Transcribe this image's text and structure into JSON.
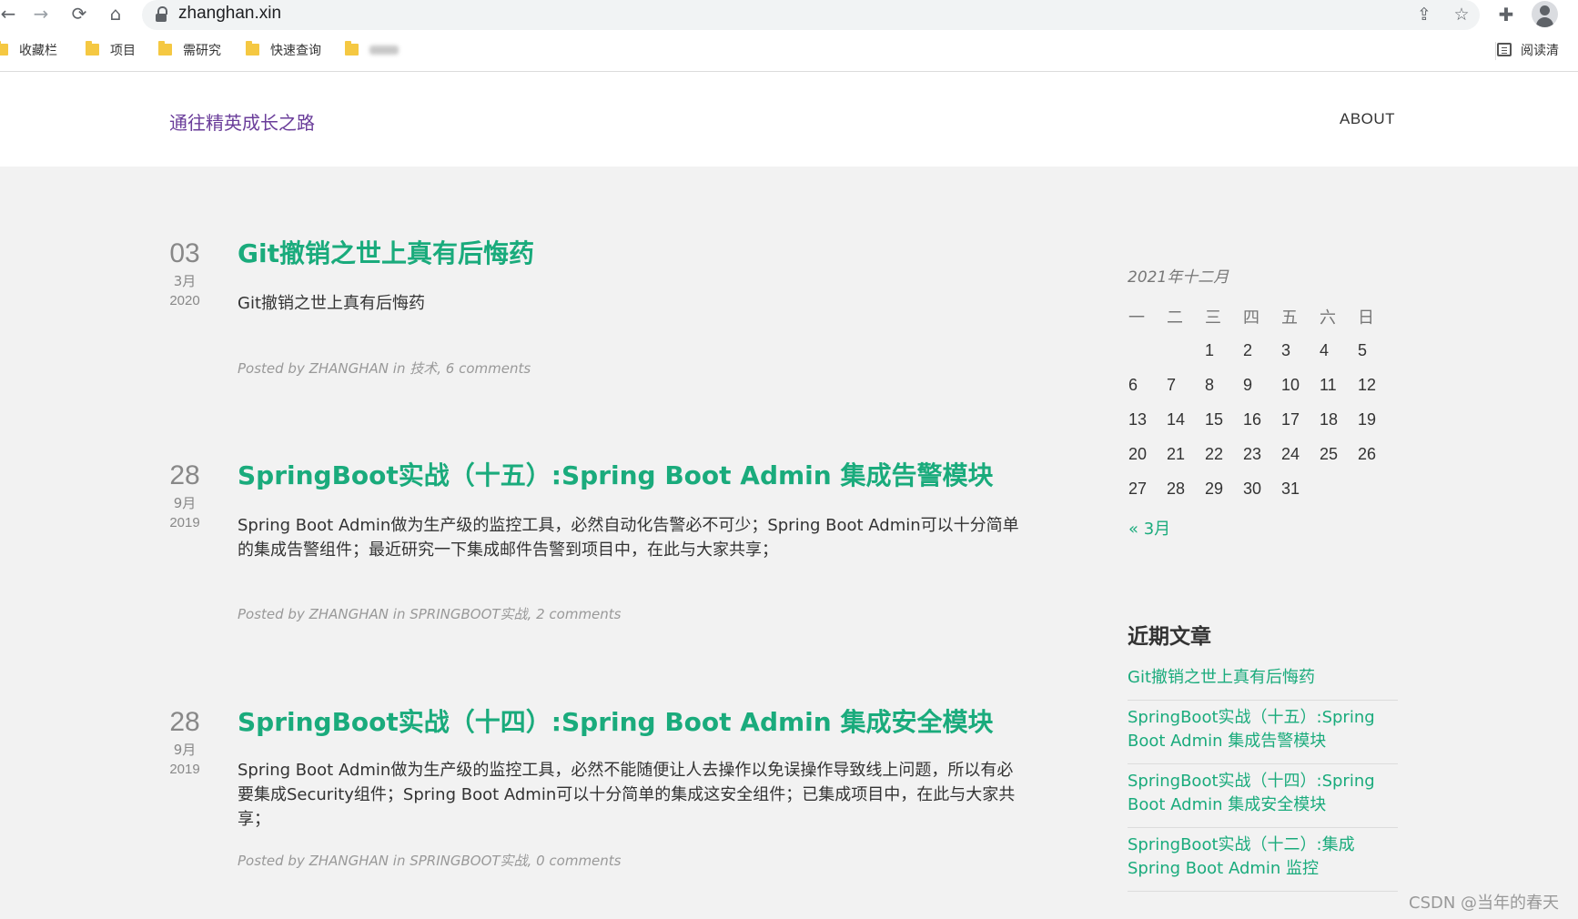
{
  "browser": {
    "url": "zhanghan.xin",
    "bookmarks": [
      "收藏栏",
      "项目",
      "需研究",
      "快速查询"
    ],
    "reader_label": "阅读清"
  },
  "site": {
    "title": "通往精英成长之路",
    "nav_about": "ABOUT"
  },
  "posts": [
    {
      "day": "03",
      "month": "3月",
      "year": "2020",
      "title": "Git撤销之世上真有后悔药",
      "excerpt": "Git撤销之世上真有后悔药",
      "meta": "Posted by ZHANGHAN in 技术, 6 comments"
    },
    {
      "day": "28",
      "month": "9月",
      "year": "2019",
      "title": "SpringBoot实战（十五）:Spring Boot Admin 集成告警模块",
      "excerpt": " Spring Boot Admin做为生产级的监控工具，必然自动化告警必不可少；Spring Boot Admin可以十分简单的集成告警组件；最近研究一下集成邮件告警到项目中，在此与大家共享；",
      "meta": "Posted by ZHANGHAN in SPRINGBOOT实战, 2 comments"
    },
    {
      "day": "28",
      "month": "9月",
      "year": "2019",
      "title": "SpringBoot实战（十四）:Spring Boot Admin 集成安全模块",
      "excerpt": "Spring Boot Admin做为生产级的监控工具，必然不能随便让人去操作以免误操作导致线上问题，所以有必要集成Security组件；Spring Boot Admin可以十分简单的集成这安全组件；已集成项目中，在此与大家共享；",
      "meta": "Posted by ZHANGHAN in SPRINGBOOT实战, 0 comments"
    }
  ],
  "calendar": {
    "caption": "2021年十二月",
    "weekdays": [
      "一",
      "二",
      "三",
      "四",
      "五",
      "六",
      "日"
    ],
    "weeks": [
      [
        "",
        "",
        "1",
        "2",
        "3",
        "4",
        "5"
      ],
      [
        "6",
        "7",
        "8",
        "9",
        "10",
        "11",
        "12"
      ],
      [
        "13",
        "14",
        "15",
        "16",
        "17",
        "18",
        "19"
      ],
      [
        "20",
        "21",
        "22",
        "23",
        "24",
        "25",
        "26"
      ],
      [
        "27",
        "28",
        "29",
        "30",
        "31",
        "",
        ""
      ]
    ],
    "prev_link": "« 3月"
  },
  "recent": {
    "title": "近期文章",
    "items": [
      "Git撤销之世上真有后悔药",
      "SpringBoot实战（十五）:Spring Boot Admin 集成告警模块",
      "SpringBoot实战（十四）:Spring Boot Admin 集成安全模块",
      "SpringBoot实战（十二）:集成 Spring Boot Admin 监控"
    ]
  },
  "watermark": "CSDN @当年的春天",
  "colors": {
    "accent": "#1aab7c",
    "site_title": "#6a3d9a",
    "background": "#f2f2f2"
  }
}
